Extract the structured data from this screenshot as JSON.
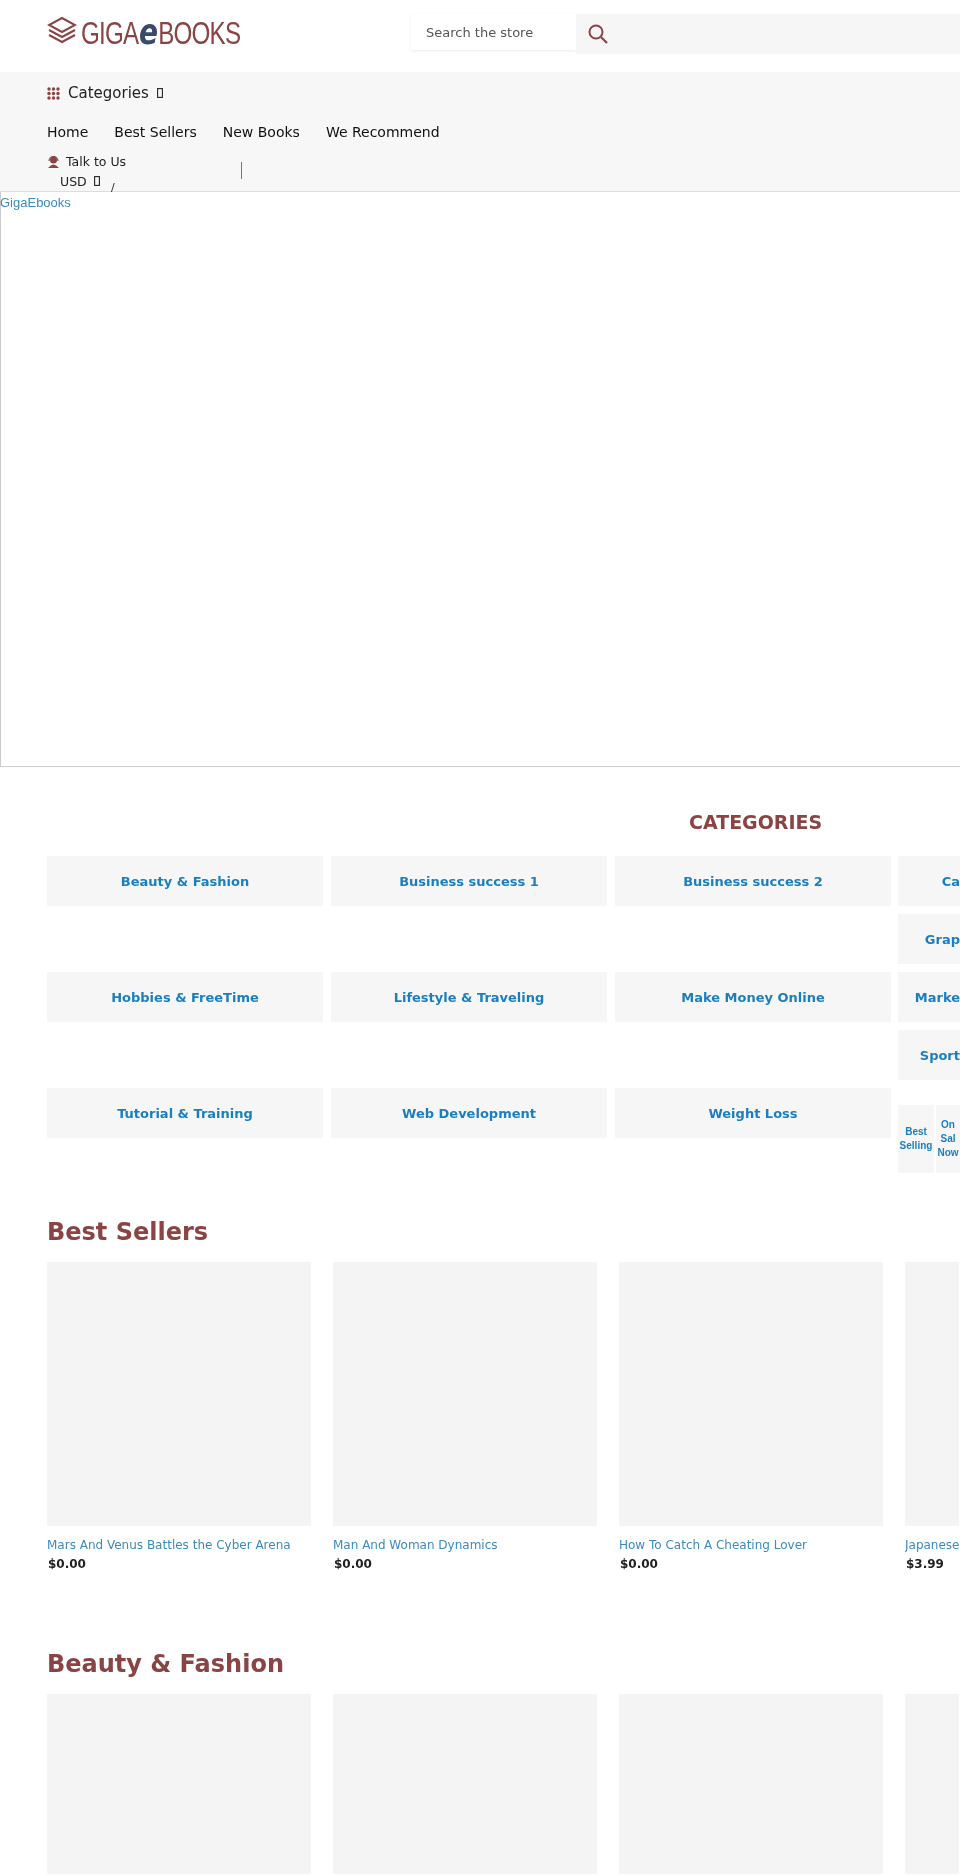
{
  "logo": {
    "prefix": "GIGA",
    "middle": "e",
    "suffix": "BOOKS"
  },
  "search": {
    "placeholder": "Search the store"
  },
  "nav": {
    "categories_label": "Categories",
    "links": [
      "Home",
      "Best Sellers",
      "New Books",
      "We Recommend"
    ],
    "contact": "Talk to Us",
    "currency": "USD",
    "separator": "/"
  },
  "breadcrumb": "GigaEbooks",
  "categories": {
    "title": "CATEGORIES",
    "tiles": [
      "Beauty & Fashion",
      "Business success 1",
      "Business success 2",
      "Hobbies & FreeTime",
      "Lifestyle & Traveling",
      "Make Money Online",
      "Tutorial & Training",
      "Web Development",
      "Weight Loss"
    ],
    "side_tiles": [
      "Ca",
      "Grap",
      "Marke",
      "Sport"
    ],
    "small_tiles": [
      "Best Selling",
      "On Sal Now"
    ]
  },
  "sections": [
    {
      "title": "Best Sellers",
      "products": [
        {
          "title": "Mars And Venus Battles the Cyber Arena",
          "price": "$0.00"
        },
        {
          "title": "Man And Woman Dynamics",
          "price": "$0.00"
        },
        {
          "title": "How To Catch A Cheating Lover",
          "price": "$0.00"
        },
        {
          "title": "Japanese",
          "price": "$3.99"
        }
      ]
    },
    {
      "title": "Beauty & Fashion"
    }
  ]
}
